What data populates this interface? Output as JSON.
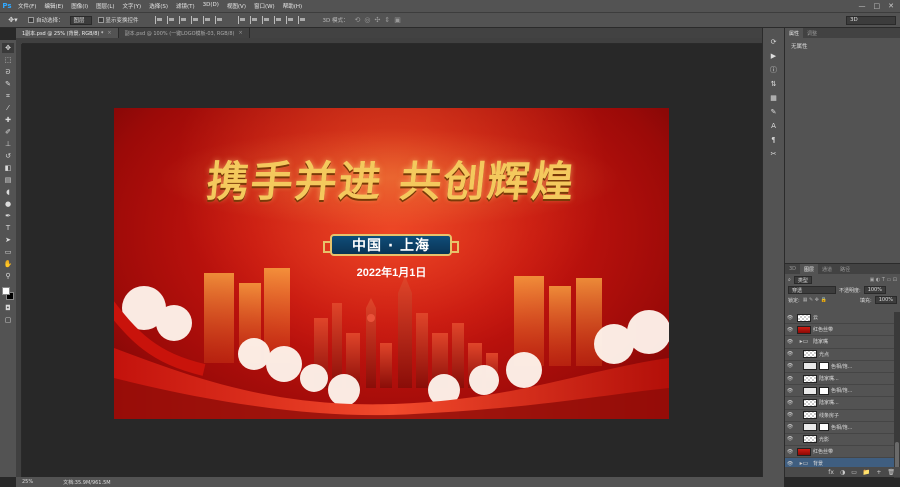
{
  "app": {
    "logo": "Ps"
  },
  "menu": [
    "文件(F)",
    "编辑(E)",
    "图像(I)",
    "图层(L)",
    "文字(Y)",
    "选择(S)",
    "滤镜(T)",
    "3D(D)",
    "视图(V)",
    "窗口(W)",
    "帮助(H)"
  ],
  "window_controls": {
    "minimize": "—",
    "maximize": "□",
    "close": "✕"
  },
  "options": {
    "auto_select_label": "自动选择：",
    "auto_select_value": "图层",
    "show_transform_label": "显示变换控件",
    "mode_3d_label": "3D 模式：",
    "workspace": "3D"
  },
  "tabs": [
    {
      "label": "1副本.psd @ 25% (背景, RGB/8) *",
      "active": true
    },
    {
      "label": "副本.psd @ 100% (一键LOGO模板-03, RGB/8)",
      "active": false
    }
  ],
  "canvas": {
    "headline": "携手并进  共创辉煌",
    "place": "中国 · 上海",
    "date": "2022年1月1日",
    "colors": {
      "bg": "#c8150f",
      "gold": "#f4c95d",
      "badge": "#0f4d7a"
    }
  },
  "properties": {
    "tabs": [
      "属性",
      "调整"
    ],
    "content": "无属性"
  },
  "layers_panel": {
    "tabs": [
      "3D",
      "图层",
      "通道",
      "路径"
    ],
    "filter_label": "类型",
    "blend_mode": "穿透",
    "opacity_label": "不透明度:",
    "opacity_value": "100%",
    "lock_label": "锁定:",
    "fill_label": "填充:",
    "fill_value": "100%",
    "layers": [
      {
        "name": "云",
        "thumb": "check",
        "indent": 0,
        "visible": true
      },
      {
        "name": "红色丝带",
        "thumb": "red",
        "indent": 0,
        "visible": true
      },
      {
        "name": "陆家嘴",
        "thumb": "folder",
        "indent": 0,
        "visible": true
      },
      {
        "name": "光点",
        "thumb": "check",
        "indent": 1,
        "visible": true
      },
      {
        "name": "色相/饱...",
        "thumb": "mask",
        "indent": 1,
        "visible": true
      },
      {
        "name": "陆家嘴...",
        "thumb": "check",
        "indent": 1,
        "visible": true
      },
      {
        "name": "色相/饱...",
        "thumb": "mask",
        "indent": 1,
        "visible": true
      },
      {
        "name": "陆家嘴...",
        "thumb": "check",
        "indent": 1,
        "visible": true
      },
      {
        "name": "线条房子",
        "thumb": "check",
        "indent": 1,
        "visible": true
      },
      {
        "name": "色相/饱...",
        "thumb": "mask",
        "indent": 1,
        "visible": true
      },
      {
        "name": "光影",
        "thumb": "check",
        "indent": 1,
        "visible": true
      },
      {
        "name": "红色丝带",
        "thumb": "red",
        "indent": 0,
        "visible": true
      },
      {
        "name": "背景",
        "thumb": "folder",
        "indent": 0,
        "visible": true,
        "selected": true
      }
    ],
    "bottom_icons": [
      "fx",
      "◑",
      "▭",
      "📁",
      "+",
      "🗑"
    ]
  },
  "status": {
    "zoom": "25%",
    "doc": "文档:35.9M/961.5M"
  }
}
